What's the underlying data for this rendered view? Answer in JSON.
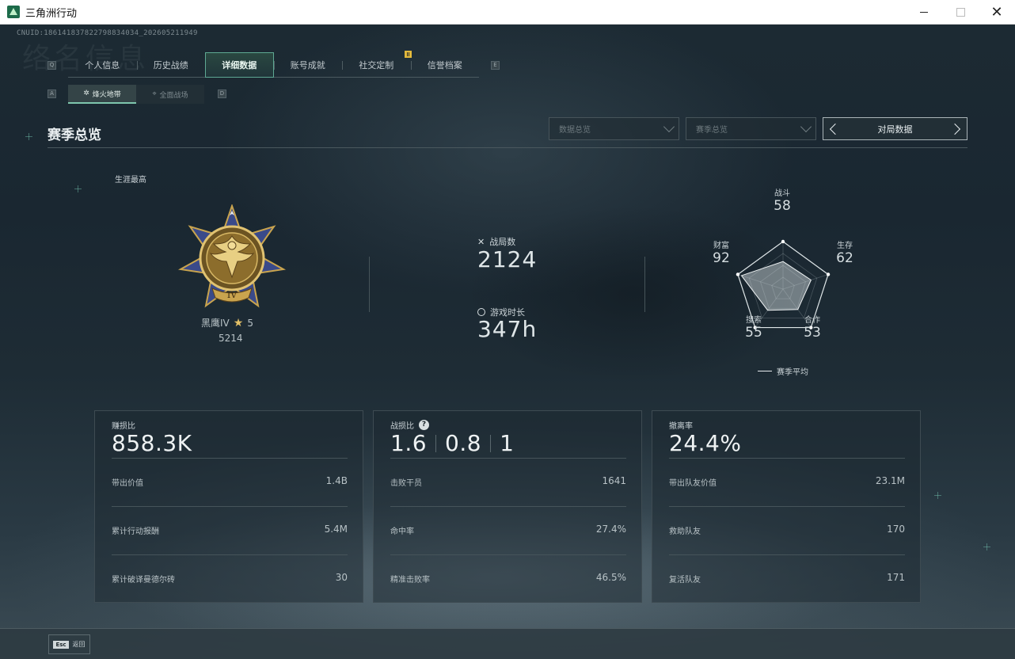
{
  "window": {
    "title": "三角洲行动"
  },
  "header": {
    "uid": "CNUID:18614183782279883403​4_202605211949",
    "bg_title": "络名信息"
  },
  "hotkeys": {
    "prev_tab": "Q",
    "next_tab": "E",
    "prev_sub": "A",
    "next_sub": "D"
  },
  "tabs": [
    {
      "label": "个人信息"
    },
    {
      "label": "历史战绩"
    },
    {
      "label": "详细数据",
      "active": true
    },
    {
      "label": "账号成就"
    },
    {
      "label": "社交定制"
    },
    {
      "label": "信誉档案"
    }
  ],
  "subtabs": [
    {
      "label": "烽火地带",
      "icon": "flame-zone-icon",
      "active": true
    },
    {
      "label": "全面战场",
      "icon": "battlefield-icon"
    }
  ],
  "section": {
    "title": "赛季总览"
  },
  "filters": {
    "dropdown1": "数据总览",
    "dropdown2": "赛季总览",
    "pager": "对局数据"
  },
  "career": {
    "label": "生涯最高",
    "rank_name": "黑鹰IV",
    "stars": "5",
    "score": "5214"
  },
  "stats": {
    "matches_label": "战局数",
    "matches_value": "2124",
    "playtime_label": "游戏时长",
    "playtime_value": "347h"
  },
  "radar": {
    "axes": [
      {
        "label": "战斗",
        "value": "58",
        "score": 58
      },
      {
        "label": "生存",
        "value": "62",
        "score": 62
      },
      {
        "label": "合作",
        "value": "53",
        "score": 53
      },
      {
        "label": "搜索",
        "value": "55",
        "score": 55
      },
      {
        "label": "财富",
        "value": "92",
        "score": 92
      }
    ],
    "legend": "赛季平均"
  },
  "cards": [
    {
      "title": "赚损比",
      "big": [
        "858.3K"
      ],
      "rows": [
        {
          "k": "带出价值",
          "v": "1.4B"
        },
        {
          "k": "累计行动报酬",
          "v": "5.4M"
        },
        {
          "k": "累计破译曼德尔砖",
          "v": "30"
        }
      ]
    },
    {
      "title": "战损比",
      "has_help": true,
      "help": "?",
      "big": [
        "1.6",
        "0.8",
        "1"
      ],
      "rows": [
        {
          "k": "击败干员",
          "v": "1641"
        },
        {
          "k": "命中率",
          "v": "27.4%"
        },
        {
          "k": "精准击败率",
          "v": "46.5%"
        }
      ]
    },
    {
      "title": "撤离率",
      "big": [
        "24.4%"
      ],
      "rows": [
        {
          "k": "带出队友价值",
          "v": "23.1M"
        },
        {
          "k": "救助队友",
          "v": "170"
        },
        {
          "k": "复活队友",
          "v": "171"
        }
      ]
    }
  ],
  "footer": {
    "esc_key": "Esc",
    "esc_label": "返回"
  },
  "colors": {
    "accent": "#5ea893",
    "medal_gold": "#c9a44e",
    "medal_blue": "#3a4a8a"
  }
}
